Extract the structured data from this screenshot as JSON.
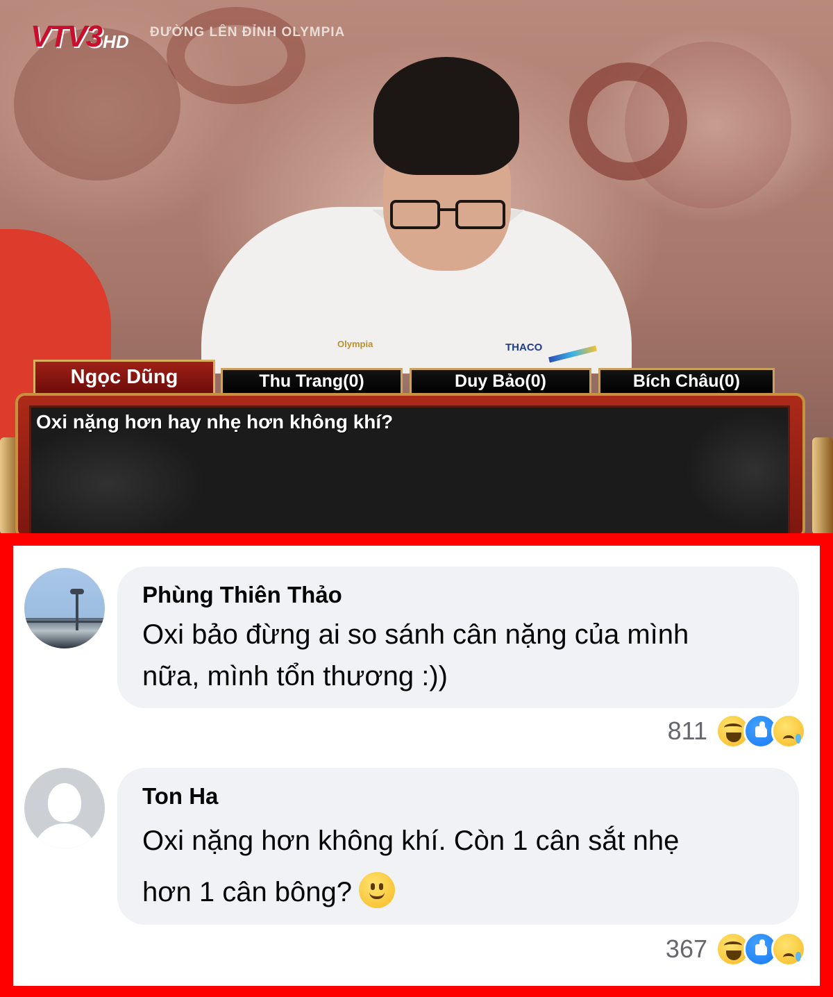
{
  "broadcast": {
    "channel_logo": "VTV3",
    "hd_label": "HD",
    "program_title": "ĐƯỜNG LÊN ĐỈNH OLYMPIA",
    "shirt_logo_olympia": "Olympia",
    "shirt_logo_thaco": "THACO",
    "contestants": [
      {
        "label": "Ngọc Dũng",
        "active": true
      },
      {
        "label": "Thu Trang(0)",
        "active": false
      },
      {
        "label": "Duy Bảo(0)",
        "active": false
      },
      {
        "label": "Bích Châu(0)",
        "active": false
      }
    ],
    "question": "Oxi nặng hơn hay nhẹ hơn không khí?"
  },
  "comments": [
    {
      "author": "Phùng Thiên Thảo",
      "text_line1": "Oxi bảo đừng ai so sánh cân nặng của mình",
      "text_line2": "nữa, mình tổn thương :))",
      "reaction_count": "811",
      "reactions": [
        "haha-icon",
        "like-icon",
        "sad-icon"
      ],
      "avatar": "profile-photo"
    },
    {
      "author": "Ton Ha",
      "text_line1": "Oxi nặng hơn không khí. Còn 1 cân sắt nhẹ",
      "text_line2": "hơn 1 cân bông?",
      "inline_emoji": "slightly-smiling-face-icon",
      "reaction_count": "367",
      "reactions": [
        "haha-icon",
        "like-icon",
        "sad-icon"
      ],
      "avatar": "default-avatar"
    }
  ],
  "colors": {
    "frame_red": "#ff0000",
    "bubble_bg": "#f0f2f5",
    "tab_active": "#9f2018",
    "tab_border": "#c9a35a",
    "board_bg": "#1b1b1b",
    "count_gray": "#65676b"
  }
}
